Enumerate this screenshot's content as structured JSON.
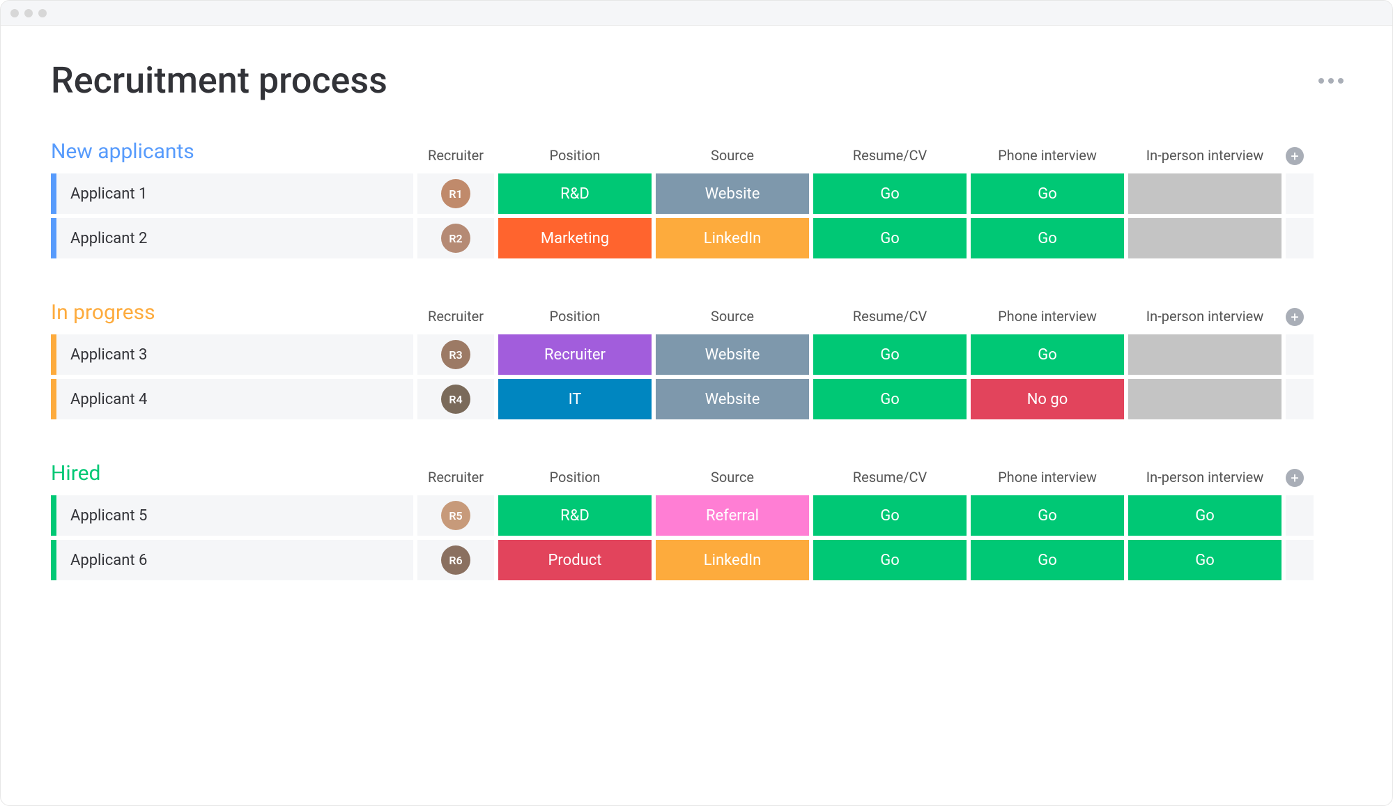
{
  "page": {
    "title": "Recruitment process"
  },
  "columns": [
    "Recruiter",
    "Position",
    "Source",
    "Resume/CV",
    "Phone interview",
    "In-person interview"
  ],
  "colors": {
    "green": "#00c875",
    "orange": "#ff642e",
    "slate": "#7e98ac",
    "amber": "#fdab3d",
    "purple": "#a25ddc",
    "blue": "#0086c0",
    "red": "#e2445c",
    "pink": "#ff7ed4",
    "greyCell": "#c4c4c4",
    "greyLight": "#f5f6f8",
    "groupBlue": "#579bfc",
    "groupAmber": "#fdab3d",
    "groupGreen": "#00c875"
  },
  "groups": [
    {
      "title": "New applicants",
      "color": "groupBlue",
      "rows": [
        {
          "name": "Applicant 1",
          "recruiter": {
            "initials": "R1",
            "bg": "#c08a6b"
          },
          "position": {
            "label": "R&D",
            "color": "green"
          },
          "source": {
            "label": "Website",
            "color": "slate"
          },
          "resume": {
            "label": "Go",
            "color": "green"
          },
          "phone": {
            "label": "Go",
            "color": "green"
          },
          "inperson": {
            "label": "",
            "color": "greyCell"
          }
        },
        {
          "name": "Applicant 2",
          "recruiter": {
            "initials": "R2",
            "bg": "#b58a74"
          },
          "position": {
            "label": "Marketing",
            "color": "orange"
          },
          "source": {
            "label": "LinkedIn",
            "color": "amber"
          },
          "resume": {
            "label": "Go",
            "color": "green"
          },
          "phone": {
            "label": "Go",
            "color": "green"
          },
          "inperson": {
            "label": "",
            "color": "greyCell"
          }
        }
      ]
    },
    {
      "title": "In progress",
      "color": "groupAmber",
      "rows": [
        {
          "name": "Applicant 3",
          "recruiter": {
            "initials": "R3",
            "bg": "#9c7a65"
          },
          "position": {
            "label": "Recruiter",
            "color": "purple"
          },
          "source": {
            "label": "Website",
            "color": "slate"
          },
          "resume": {
            "label": "Go",
            "color": "green"
          },
          "phone": {
            "label": "Go",
            "color": "green"
          },
          "inperson": {
            "label": "",
            "color": "greyCell"
          }
        },
        {
          "name": "Applicant 4",
          "recruiter": {
            "initials": "R4",
            "bg": "#7a6a5a"
          },
          "position": {
            "label": "IT",
            "color": "blue"
          },
          "source": {
            "label": "Website",
            "color": "slate"
          },
          "resume": {
            "label": "Go",
            "color": "green"
          },
          "phone": {
            "label": "No go",
            "color": "red"
          },
          "inperson": {
            "label": "",
            "color": "greyCell"
          }
        }
      ]
    },
    {
      "title": "Hired",
      "color": "groupGreen",
      "rows": [
        {
          "name": "Applicant 5",
          "recruiter": {
            "initials": "R5",
            "bg": "#c79a7a"
          },
          "position": {
            "label": "R&D",
            "color": "green"
          },
          "source": {
            "label": "Referral",
            "color": "pink"
          },
          "resume": {
            "label": "Go",
            "color": "green"
          },
          "phone": {
            "label": "Go",
            "color": "green"
          },
          "inperson": {
            "label": "Go",
            "color": "green"
          }
        },
        {
          "name": "Applicant 6",
          "recruiter": {
            "initials": "R6",
            "bg": "#8a7060"
          },
          "position": {
            "label": "Product",
            "color": "red"
          },
          "source": {
            "label": "LinkedIn",
            "color": "amber"
          },
          "resume": {
            "label": "Go",
            "color": "green"
          },
          "phone": {
            "label": "Go",
            "color": "green"
          },
          "inperson": {
            "label": "Go",
            "color": "green"
          }
        }
      ]
    }
  ]
}
